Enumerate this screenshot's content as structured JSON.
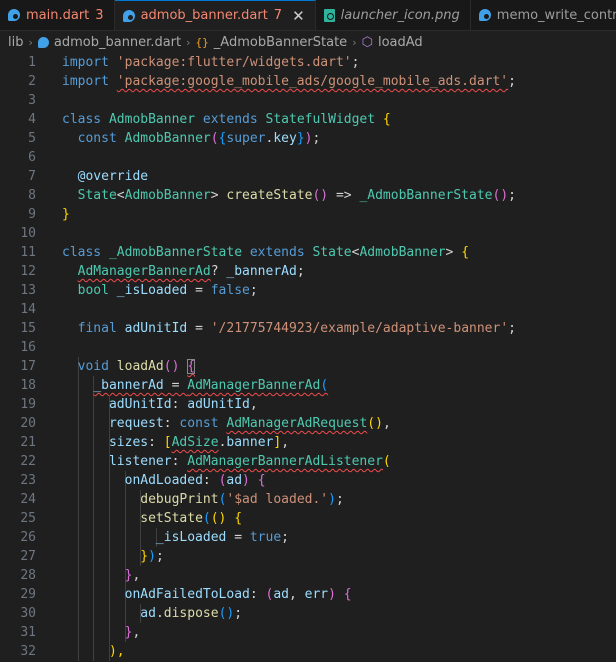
{
  "colors": {
    "background": "#1f1f1f",
    "tabbar": "#181818",
    "active_tab_border": "#0078d4",
    "error": "#f48771",
    "squiggle": "#f14c4c"
  },
  "tabs": [
    {
      "label": "main.dart",
      "badge": "3",
      "icon": "dart-file-icon",
      "active": false,
      "error": true
    },
    {
      "label": "admob_banner.dart",
      "badge": "7",
      "icon": "dart-file-icon",
      "active": true,
      "error": true,
      "close": "✕"
    },
    {
      "label": "launcher_icon.png",
      "badge": "",
      "icon": "image-file-icon",
      "active": false,
      "italic": true
    },
    {
      "label": "memo_write_control",
      "badge": "",
      "icon": "dart-file-icon",
      "active": false
    }
  ],
  "breadcrumb": {
    "items": [
      "lib",
      "admob_banner.dart",
      "_AdmobBannerState",
      "loadAd"
    ],
    "separator": "›",
    "class_icon": "{}",
    "method_icon": "⬡"
  },
  "editor": {
    "lines": [
      {
        "n": "1",
        "tokens": [
          [
            "kw",
            "import"
          ],
          [
            "plain",
            " "
          ],
          [
            "str",
            "'package:flutter/widgets.dart'"
          ],
          [
            "plain",
            ";"
          ]
        ]
      },
      {
        "n": "2",
        "tokens": [
          [
            "kw",
            "import"
          ],
          [
            "plain",
            " "
          ],
          [
            "str sq",
            "'package:google_mobile_ads/google_mobile_ads.dart'"
          ],
          [
            "plain",
            ";"
          ]
        ]
      },
      {
        "n": "3",
        "tokens": []
      },
      {
        "n": "4",
        "tokens": [
          [
            "kw",
            "class"
          ],
          [
            "plain",
            " "
          ],
          [
            "type",
            "AdmobBanner"
          ],
          [
            "plain",
            " "
          ],
          [
            "kw",
            "extends"
          ],
          [
            "plain",
            " "
          ],
          [
            "type",
            "StatefulWidget"
          ],
          [
            "plain",
            " "
          ],
          [
            "b1",
            "{"
          ]
        ]
      },
      {
        "n": "5",
        "tokens": [
          [
            "plain",
            "  "
          ],
          [
            "kw",
            "const"
          ],
          [
            "plain",
            " "
          ],
          [
            "type",
            "AdmobBanner"
          ],
          [
            "b2",
            "("
          ],
          [
            "b3",
            "{"
          ],
          [
            "kw",
            "super"
          ],
          [
            "plain",
            "."
          ],
          [
            "var",
            "key"
          ],
          [
            "b3",
            "}"
          ],
          [
            "b2",
            ")"
          ],
          [
            "plain",
            ";"
          ]
        ]
      },
      {
        "n": "6",
        "tokens": []
      },
      {
        "n": "7",
        "tokens": [
          [
            "plain",
            "  "
          ],
          [
            "var",
            "@override"
          ]
        ]
      },
      {
        "n": "8",
        "tokens": [
          [
            "plain",
            "  "
          ],
          [
            "type",
            "State"
          ],
          [
            "plain",
            "<"
          ],
          [
            "type",
            "AdmobBanner"
          ],
          [
            "plain",
            "> "
          ],
          [
            "fn",
            "createState"
          ],
          [
            "b2",
            "()"
          ],
          [
            "plain",
            " => "
          ],
          [
            "type",
            "_AdmobBannerState"
          ],
          [
            "b2",
            "()"
          ],
          [
            "plain",
            ";"
          ]
        ]
      },
      {
        "n": "9",
        "tokens": [
          [
            "b1",
            "}"
          ]
        ]
      },
      {
        "n": "10",
        "tokens": []
      },
      {
        "n": "11",
        "tokens": [
          [
            "kw",
            "class"
          ],
          [
            "plain",
            " "
          ],
          [
            "type",
            "_AdmobBannerState"
          ],
          [
            "plain",
            " "
          ],
          [
            "kw",
            "extends"
          ],
          [
            "plain",
            " "
          ],
          [
            "type",
            "State"
          ],
          [
            "plain",
            "<"
          ],
          [
            "type",
            "AdmobBanner"
          ],
          [
            "plain",
            "> "
          ],
          [
            "b1",
            "{"
          ]
        ]
      },
      {
        "n": "12",
        "tokens": [
          [
            "plain",
            "  "
          ],
          [
            "type sq",
            "AdManagerBannerAd"
          ],
          [
            "plain",
            "? "
          ],
          [
            "var",
            "_bannerAd"
          ],
          [
            "plain",
            ";"
          ]
        ]
      },
      {
        "n": "13",
        "tokens": [
          [
            "plain",
            "  "
          ],
          [
            "type",
            "bool"
          ],
          [
            "plain",
            " "
          ],
          [
            "var",
            "_isLoaded"
          ],
          [
            "plain",
            " = "
          ],
          [
            "kw",
            "false"
          ],
          [
            "plain",
            ";"
          ]
        ]
      },
      {
        "n": "14",
        "tokens": []
      },
      {
        "n": "15",
        "tokens": [
          [
            "plain",
            "  "
          ],
          [
            "kw",
            "final"
          ],
          [
            "plain",
            " "
          ],
          [
            "var",
            "adUnitId"
          ],
          [
            "plain",
            " = "
          ],
          [
            "str",
            "'/21775744923/example/adaptive-banner'"
          ],
          [
            "plain",
            ";"
          ]
        ]
      },
      {
        "n": "16",
        "tokens": []
      },
      {
        "n": "17",
        "tokens": [
          [
            "plain",
            "  "
          ],
          [
            "kw",
            "void"
          ],
          [
            "plain",
            " "
          ],
          [
            "fn",
            "loadAd"
          ],
          [
            "b2",
            "()"
          ],
          [
            "plain",
            " "
          ],
          [
            "b2 hl sq",
            "{"
          ]
        ]
      },
      {
        "n": "18",
        "tokens": [
          [
            "plain",
            "    "
          ],
          [
            "var sq",
            "_bannerAd"
          ],
          [
            "plain sq",
            " = "
          ],
          [
            "type sq",
            "AdManagerBannerAd"
          ],
          [
            "b3 sq",
            "("
          ]
        ]
      },
      {
        "n": "19",
        "tokens": [
          [
            "plain",
            "      "
          ],
          [
            "var",
            "adUnitId"
          ],
          [
            "plain",
            ": "
          ],
          [
            "var",
            "adUnitId"
          ],
          [
            "plain",
            ","
          ]
        ]
      },
      {
        "n": "20",
        "tokens": [
          [
            "plain",
            "      "
          ],
          [
            "var",
            "request"
          ],
          [
            "plain",
            ": "
          ],
          [
            "kw",
            "const"
          ],
          [
            "plain",
            " "
          ],
          [
            "type sq",
            "AdManagerAdRequest"
          ],
          [
            "b1",
            "()"
          ],
          [
            "plain",
            ","
          ]
        ]
      },
      {
        "n": "21",
        "tokens": [
          [
            "plain",
            "      "
          ],
          [
            "var",
            "sizes"
          ],
          [
            "plain",
            ": "
          ],
          [
            "b1",
            "["
          ],
          [
            "type sq",
            "AdSize"
          ],
          [
            "plain",
            "."
          ],
          [
            "var",
            "banner"
          ],
          [
            "b1",
            "]"
          ],
          [
            "plain",
            ","
          ]
        ]
      },
      {
        "n": "22",
        "tokens": [
          [
            "plain",
            "      "
          ],
          [
            "var",
            "listener"
          ],
          [
            "plain",
            ": "
          ],
          [
            "type sq",
            "AdManagerBannerAdListener"
          ],
          [
            "b1",
            "("
          ]
        ]
      },
      {
        "n": "23",
        "tokens": [
          [
            "plain",
            "        "
          ],
          [
            "var",
            "onAdLoaded"
          ],
          [
            "plain",
            ": "
          ],
          [
            "b2",
            "("
          ],
          [
            "var",
            "ad"
          ],
          [
            "b2",
            ")"
          ],
          [
            "plain",
            " "
          ],
          [
            "b2",
            "{"
          ]
        ]
      },
      {
        "n": "24",
        "tokens": [
          [
            "plain",
            "          "
          ],
          [
            "fn",
            "debugPrint"
          ],
          [
            "b3",
            "("
          ],
          [
            "str",
            "'$ad loaded.'"
          ],
          [
            "b3",
            ")"
          ],
          [
            "plain",
            ";"
          ]
        ]
      },
      {
        "n": "25",
        "tokens": [
          [
            "plain",
            "          "
          ],
          [
            "fn",
            "setState"
          ],
          [
            "b3",
            "("
          ],
          [
            "b1",
            "()"
          ],
          [
            "plain",
            " "
          ],
          [
            "b1",
            "{"
          ]
        ]
      },
      {
        "n": "26",
        "tokens": [
          [
            "plain",
            "            "
          ],
          [
            "var",
            "_isLoaded"
          ],
          [
            "plain",
            " = "
          ],
          [
            "kw",
            "true"
          ],
          [
            "plain",
            ";"
          ]
        ]
      },
      {
        "n": "27",
        "tokens": [
          [
            "plain",
            "          "
          ],
          [
            "b1",
            "}"
          ],
          [
            "b3",
            ")"
          ],
          [
            "plain",
            ";"
          ]
        ]
      },
      {
        "n": "28",
        "tokens": [
          [
            "plain",
            "        "
          ],
          [
            "b2",
            "}"
          ],
          [
            "plain",
            ","
          ]
        ]
      },
      {
        "n": "29",
        "tokens": [
          [
            "plain",
            "        "
          ],
          [
            "var",
            "onAdFailedToLoad"
          ],
          [
            "plain",
            ": "
          ],
          [
            "b2",
            "("
          ],
          [
            "var",
            "ad"
          ],
          [
            "plain",
            ", "
          ],
          [
            "var",
            "err"
          ],
          [
            "b2",
            ")"
          ],
          [
            "plain",
            " "
          ],
          [
            "b2",
            "{"
          ]
        ]
      },
      {
        "n": "30",
        "tokens": [
          [
            "plain",
            "          "
          ],
          [
            "var",
            "ad"
          ],
          [
            "plain",
            "."
          ],
          [
            "fn",
            "dispose"
          ],
          [
            "b3",
            "()"
          ],
          [
            "plain",
            ";"
          ]
        ]
      },
      {
        "n": "31",
        "tokens": [
          [
            "plain",
            "        "
          ],
          [
            "b2",
            "}"
          ],
          [
            "plain",
            ","
          ]
        ]
      },
      {
        "n": "32",
        "tokens": [
          [
            "plain",
            "      "
          ],
          [
            "b1",
            "),"
          ]
        ]
      }
    ]
  }
}
